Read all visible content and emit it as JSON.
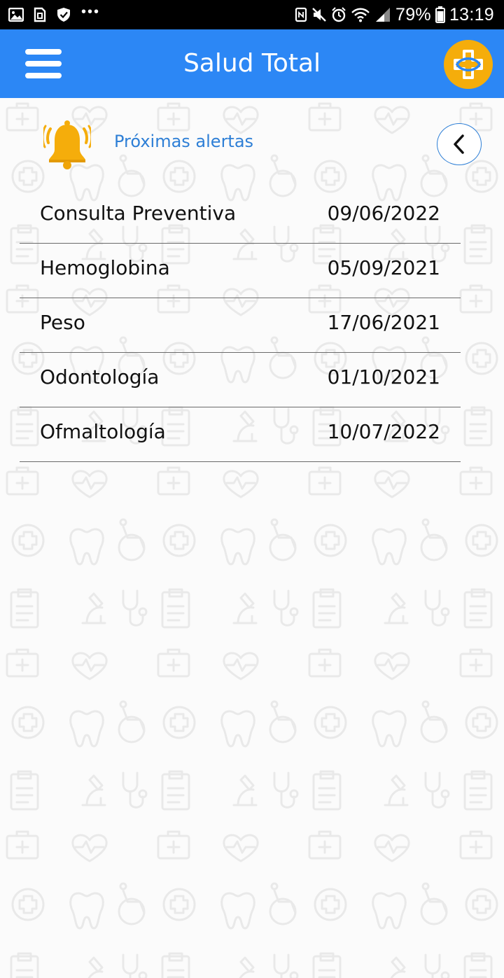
{
  "status_bar": {
    "left_icons": [
      "gallery-icon",
      "sim-icon",
      "shield-icon",
      "more-dots-icon"
    ],
    "right_icons": [
      "nfc-icon",
      "mute-icon",
      "alarm-icon",
      "wifi-icon",
      "signal-icon",
      "battery-icon"
    ],
    "battery": "79%",
    "time": "13:19",
    "dots": "•••"
  },
  "header": {
    "title": "Salud Total",
    "menu_icon": "hamburger-menu-icon",
    "brand_icon": "health-cross-logo-icon",
    "color": "#2c87f5",
    "brand_color": "#f5ad0b"
  },
  "alerts": {
    "title": "Próximas alertas",
    "bell_icon": "bell-ringing-icon",
    "back_icon": "chevron-left-icon",
    "accent": "#2e7fd6",
    "items": [
      {
        "name": "Consulta Preventiva",
        "date": "09/06/2022"
      },
      {
        "name": "Hemoglobina",
        "date": "05/09/2021"
      },
      {
        "name": "Peso",
        "date": "17/06/2021"
      },
      {
        "name": "Odontología",
        "date": "01/10/2021"
      },
      {
        "name": "Ofmaltología",
        "date": "10/07/2022"
      }
    ]
  }
}
